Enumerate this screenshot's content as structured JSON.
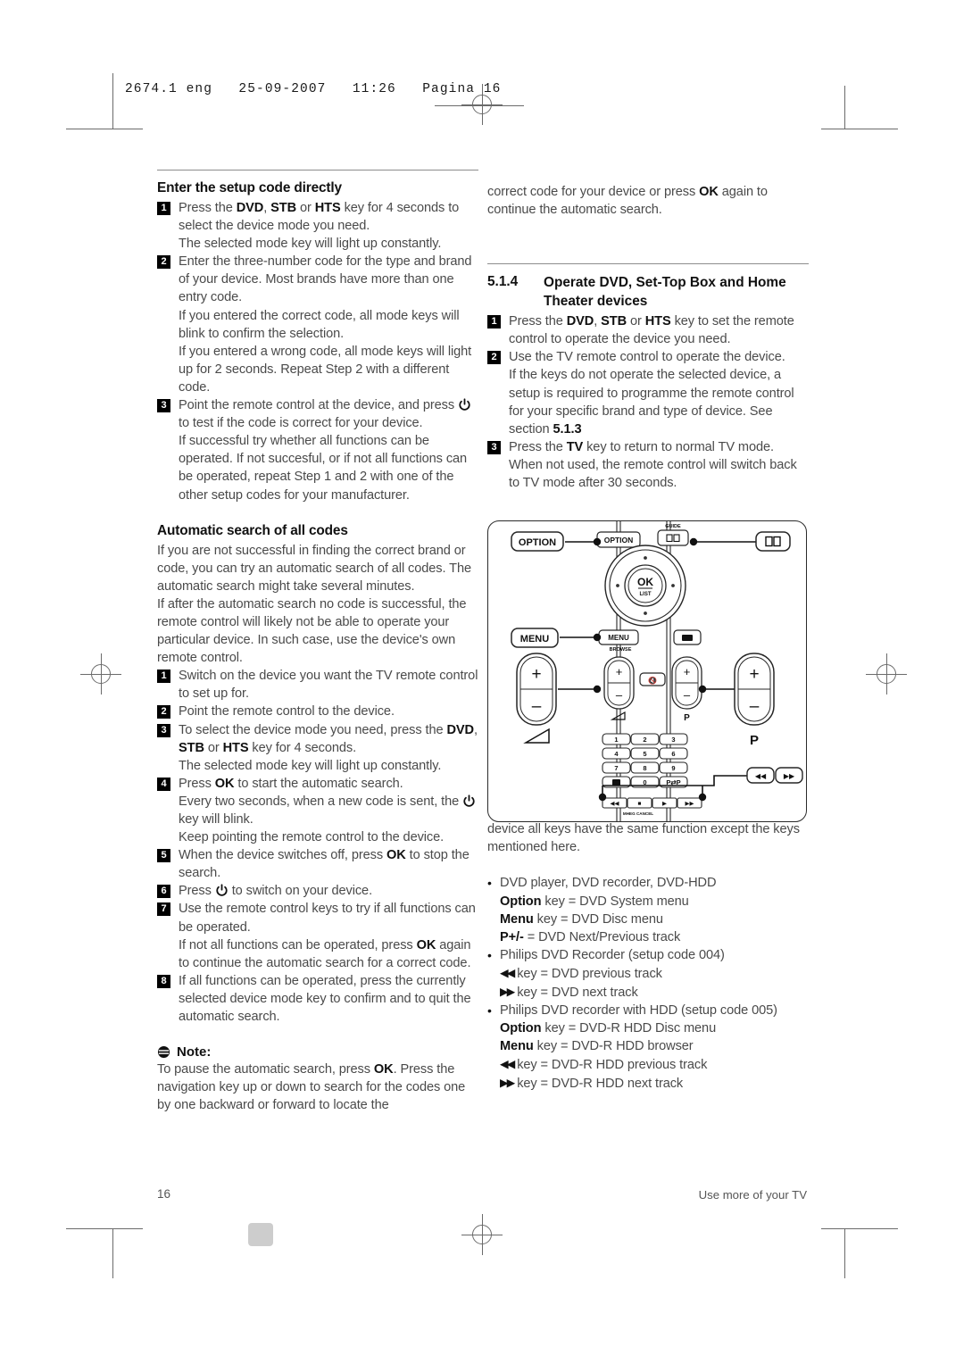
{
  "print_header": "2674.1 eng   25-09-2007   11:26   Pagina 16",
  "left_column": {
    "heading1": "Enter the setup code directly",
    "steps1": [
      {
        "num": "1",
        "lines": [
          "Press the <b>DVD</b>, <b>STB</b>  or <b>HTS</b>  key for 4 seconds to select the device mode you need.",
          "The selected mode key will light up constantly."
        ]
      },
      {
        "num": "2",
        "lines": [
          "Enter the three-number code for the type and brand of your device. Most brands have more than one entry code.",
          "If you entered the correct code,  all mode keys will blink to confirm the selection.",
          "If you entered a wrong code, all mode keys will light up for 2 seconds. Repeat Step 2 with a different code."
        ]
      },
      {
        "num": "3",
        "lines": [
          "Point the remote control at the device, and press POWERICON to test if the code is correct for your device.",
          "If successful try whether all functions can be operated. If not succesful, or if not all functions can be operated, repeat Step 1 and 2 with one of the other setup codes for your manufacturer."
        ]
      }
    ],
    "heading2": "Automatic search of all codes",
    "intro": [
      "If you are not successful in finding the correct brand or code, you can try an automatic search of all codes. The automatic search might take several minutes.",
      "If after the automatic search no code is successful, the remote control will likely not be able to operate your particular device. In such case, use the device's own remote control."
    ],
    "steps2": [
      {
        "num": "1",
        "lines": [
          "Switch on the device you want the TV remote control to set up for."
        ]
      },
      {
        "num": "2",
        "lines": [
          "Point the remote control to the device."
        ]
      },
      {
        "num": "3",
        "lines": [
          "To select the device mode you need, press the <b>DVD</b>, <b>STB</b> or <b>HTS</b> key for 4 seconds.",
          "The selected mode key will light up constantly."
        ]
      },
      {
        "num": "4",
        "lines": [
          "Press <b>OK</b> to start the automatic search.",
          "Every two seconds, when a new code is sent, the POWERICON key will blink.",
          "Keep pointing the remote control to the device."
        ]
      },
      {
        "num": "5",
        "lines": [
          "When the device switches off, press <b>OK</b> to stop the search."
        ]
      },
      {
        "num": "6",
        "lines": [
          "Press POWERICON to switch on your device."
        ]
      },
      {
        "num": "7",
        "lines": [
          "Use the remote control keys to try if all functions can be operated.",
          "If not all functions can be operated, press <b>OK</b> again to continue the automatic search for a correct code."
        ]
      },
      {
        "num": "8",
        "lines": [
          "If all functions can be operated, press the currently selected device mode key to confirm and to quit the automatic search."
        ]
      }
    ],
    "note_label": "Note",
    "note_colon": ":",
    "note_text": "To pause the automatic search, press <b>OK</b>. Press the navigation key up or down to search for the codes one by one backward or forward to locate the"
  },
  "right_column": {
    "continuation": "correct code for your device or press <b>OK</b> again to continue the automatic search.",
    "section_number": "5.1.4",
    "section_title": "Operate DVD, Set-Top Box and Home Theater devices",
    "steps": [
      {
        "num": "1",
        "lines": [
          "Press the <b>DVD</b>, <b>STB</b> or <b>HTS</b> key to set the remote control to operate the device you need."
        ]
      },
      {
        "num": "2",
        "lines": [
          "Use the TV remote control to operate the device.",
          "If the keys do not operate the selected device, a setup is required to programme the remote control for your specific brand and type of device. See section <b>5.1.3</b>"
        ]
      },
      {
        "num": "3",
        "lines": [
          "Press the <b>TV</b> key to return to normal TV mode.",
          "When not used, the remote control will switch back to TV mode after 30 seconds."
        ]
      }
    ],
    "after_figure": "When the remote control is selected for a particular device all keys have the same function except the keys mentioned here.",
    "bullets": [
      {
        "title": "DVD player, DVD recorder, DVD-HDD",
        "lines": [
          "<b>Option</b> key = DVD System menu",
          "<b>Menu</b> key = DVD Disc menu",
          "<b>P+/-</b> = DVD Next/Previous track"
        ]
      },
      {
        "title": "Philips DVD Recorder (setup code 004)",
        "lines": [
          "REWICON key = DVD previous track",
          "FFWICON key = DVD next track"
        ]
      },
      {
        "title": "Philips DVD recorder with HDD (setup code 005)",
        "lines": [
          "<b>Option</b> key = DVD-R HDD Disc menu",
          "<b>Menu</b> key = DVD-R HDD browser",
          "REWICON key = DVD-R HDD previous track",
          "FFWICON key = DVD-R HDD next track"
        ]
      }
    ]
  },
  "figure": {
    "callout_labels": {
      "option": "OPTION",
      "menu": "MENU",
      "guide": "GUIDE",
      "ok": "OK",
      "list": "LIST",
      "browse": "BROWSE",
      "volume": "volume-rocker",
      "program": "P",
      "plus": "+",
      "minus": "–",
      "mheg": "MHEG CANCEL",
      "prev": "◄◄",
      "next": "►►",
      "stop": "■",
      "play": "►"
    },
    "keypad": [
      "1",
      "2",
      "3",
      "4",
      "5",
      "6",
      "7",
      "8",
      "9",
      "▣",
      "0",
      "P⇆P"
    ]
  },
  "footer": {
    "page_number": "16",
    "running_title": "Use more of your TV"
  },
  "colors": {
    "ink": "#2b2b2b",
    "body": "#4a4a4a",
    "bold": "#111111",
    "rule": "#8d8d8d",
    "mark": "#6b6b6b",
    "gray_box": "#cdcdcd"
  }
}
